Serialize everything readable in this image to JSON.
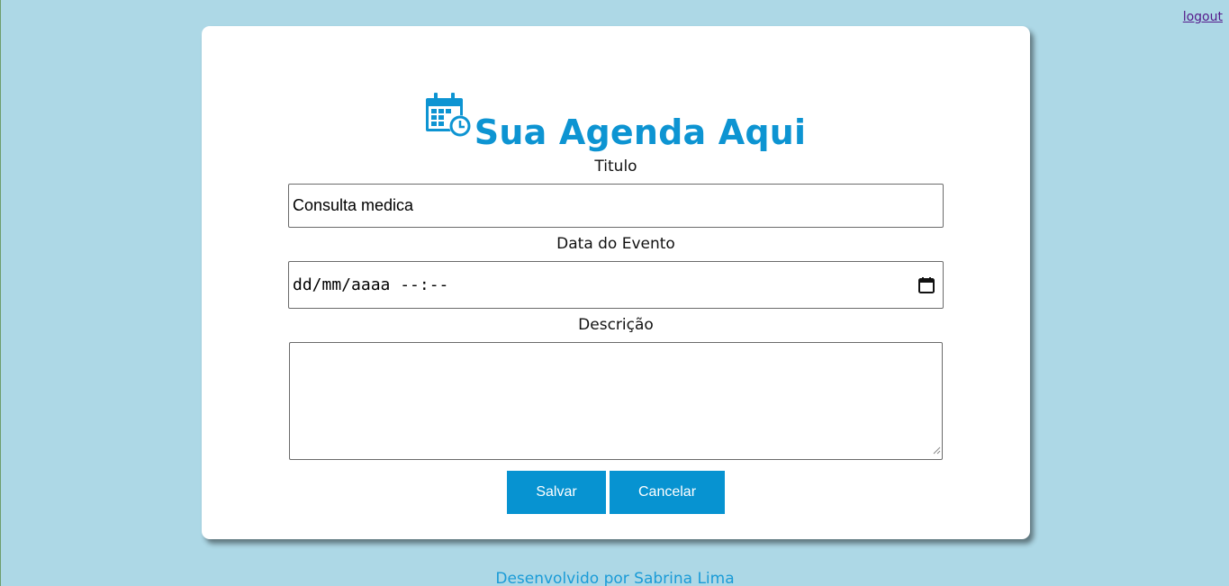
{
  "nav": {
    "logout_label": "logout"
  },
  "header": {
    "title": "Sua Agenda Aqui",
    "icon": "calendar-clock-icon"
  },
  "form": {
    "titulo": {
      "label": "Titulo",
      "value": "Consulta medica"
    },
    "data_evento": {
      "label": "Data do Evento",
      "value": "dd/mm/aaaa --:--"
    },
    "descricao": {
      "label": "Descrição",
      "value": ""
    }
  },
  "buttons": {
    "save_label": "Salvar",
    "cancel_label": "Cancelar"
  },
  "footer": {
    "credit": "Desenvolvido por Sabrina Lima"
  },
  "colors": {
    "background": "#add8e6",
    "accent": "#0d94d2",
    "button": "#0793d1"
  }
}
